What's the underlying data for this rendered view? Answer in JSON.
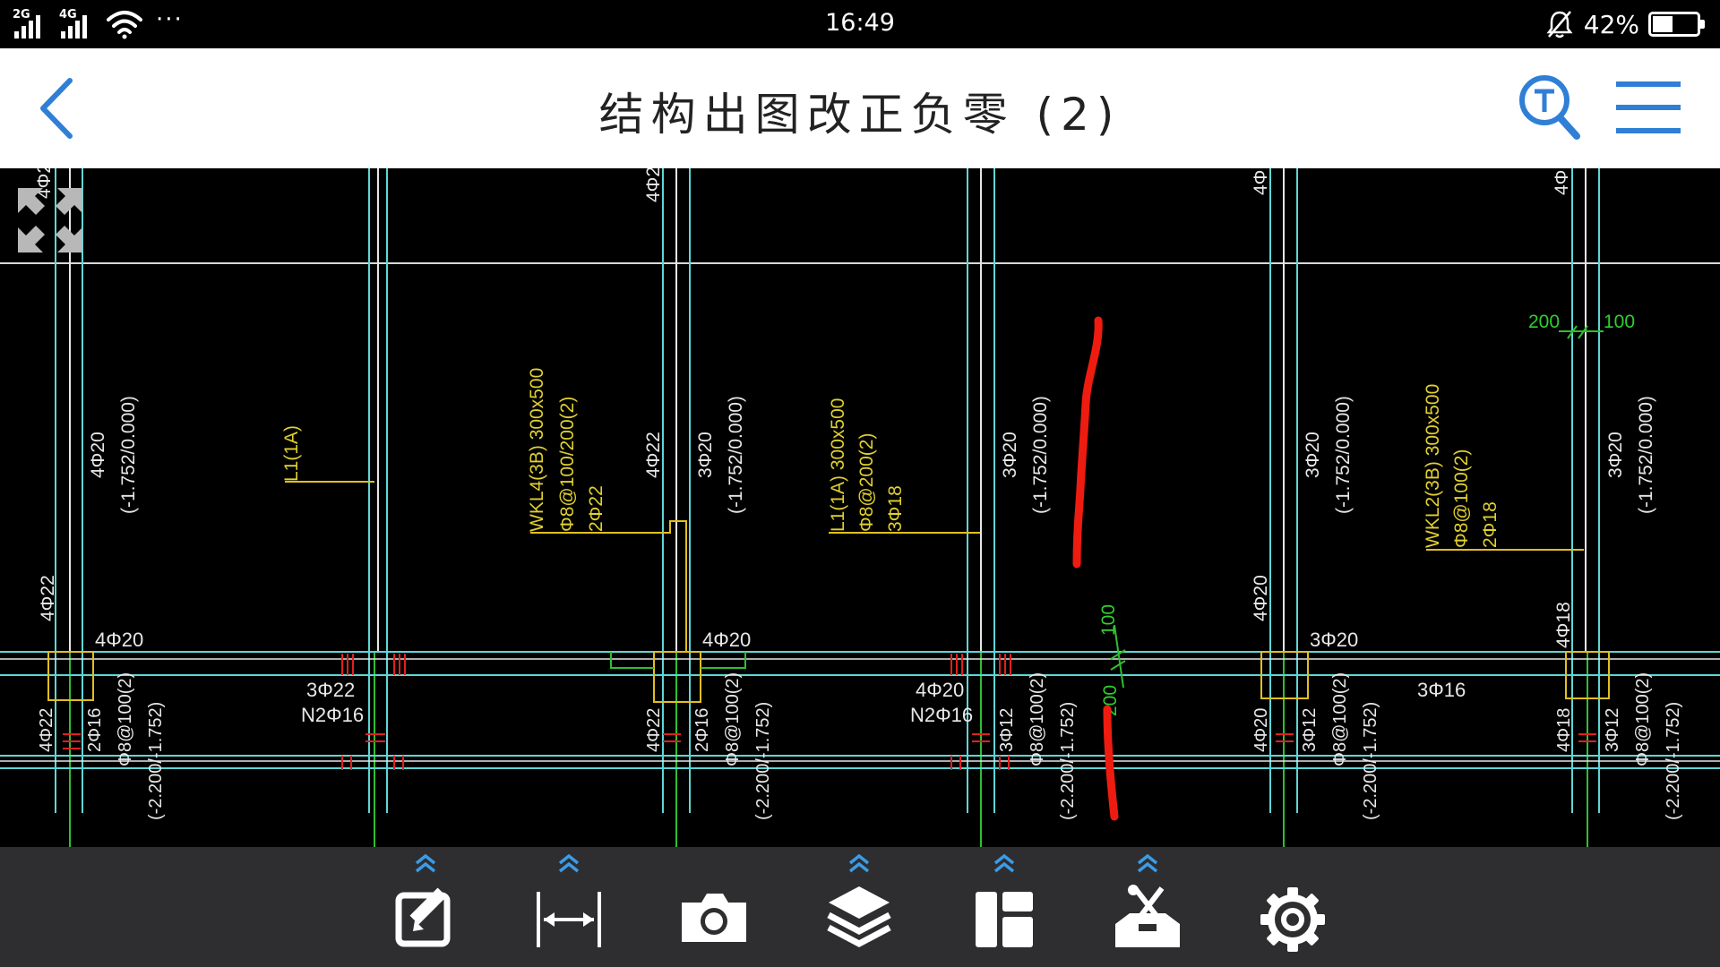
{
  "status_bar": {
    "network_1": "2G",
    "network_2": "4G",
    "more": "···",
    "time": "16:49",
    "battery_percent": "42%",
    "battery_level": 0.42
  },
  "header": {
    "title": "结构出图改正负零 (2)",
    "accent_color": "#2f7fd6"
  },
  "drawing": {
    "beam_labels": {
      "wkl4": "WKL4(3B) 300x500",
      "wkl4_stirrup": "Φ8@100/200(2)",
      "wkl4_bars": "2Φ22",
      "l1_left": "L1(1A)",
      "l1_mid": "L1(1A) 300x500",
      "l1_mid_stirrup": "Φ8@200(2)",
      "l1_mid_bars": "3Φ18",
      "wkl2": "WKL2(3B) 300x500",
      "wkl2_stirrup": "Φ8@100(2)",
      "wkl2_bars": "2Φ18"
    },
    "column_labels": {
      "c1_top": "4Φ20",
      "c1_elev": "(-1.752/0.000)",
      "c2_top": "3Φ20",
      "c2_elev": "(-1.752/0.000)",
      "c3_top": "3Φ20",
      "c3_elev": "(-1.752/0.000)",
      "c4_top": "3Φ20",
      "c4_elev": "(-1.752/0.000)",
      "c5_top": "3Φ20",
      "c5_elev": "(-1.752/0.000)",
      "col_4022_a": "4Φ22",
      "col_4022_b": "4Φ22",
      "col_4020_right": "4Φ20",
      "col_4018": "4Φ18",
      "top_cut_1": "4Φ2",
      "top_cut_2": "4Φ2",
      "top_cut_3": "4Φ",
      "top_cut_4": "4Φ",
      "top_cut_5": "4Φ"
    },
    "beam_bar_labels": {
      "b1": "4Φ20",
      "b2": "4Φ20",
      "b3": "3Φ20",
      "span1_main": "3Φ22",
      "span1_n": "N2Φ16",
      "span2_main": "4Φ20",
      "span2_n": "N2Φ16",
      "span3_main": "3Φ16"
    },
    "bottom_labels": {
      "g1_a": "4Φ22",
      "g1_b": "2Φ16",
      "g1_c": "Φ8@100(2)",
      "g1_d": "(-2.200/-1.752)",
      "g2_a": "4Φ22",
      "g2_b": "2Φ16",
      "g2_c": "Φ8@100(2)",
      "g2_d": "(-2.200/-1.752)",
      "g3_b": "3Φ12",
      "g3_c": "Φ8@100(2)",
      "g3_d": "(-2.200/-1.752)",
      "g4_a": "4Φ20",
      "g4_b": "3Φ12",
      "g4_c": "Φ8@100(2)",
      "g4_d": "(-2.200/-1.752)",
      "g5_a": "4Φ18",
      "g5_b": "3Φ12",
      "g5_c": "Φ8@100(2)",
      "g5_d": "(-2.200/-1.752)"
    },
    "dimensions": {
      "d200": "200",
      "d100": "100",
      "d100_vert": "100",
      "d200_vert": "200"
    }
  },
  "toolbar": {
    "tools": [
      "annotate-icon",
      "measure-icon",
      "camera-icon",
      "layers-icon",
      "layout-icon",
      "toolbox-icon",
      "settings-icon"
    ]
  }
}
